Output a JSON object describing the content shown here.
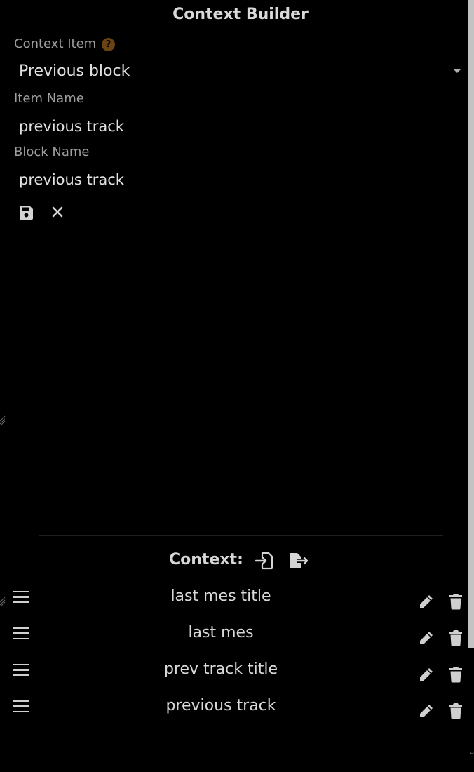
{
  "panel": {
    "title": "Context Builder",
    "context_item_label": "Context Item",
    "help_glyph": "?",
    "context_item_value": "Previous block",
    "item_name_label": "Item Name",
    "item_name_value": "previous track",
    "block_name_label": "Block Name",
    "block_name_value": "previous track",
    "save_icon": "floppy-disk-icon",
    "cancel_icon": "close-icon"
  },
  "context": {
    "header": "Context:",
    "import_icon": "file-import-icon",
    "export_icon": "file-export-icon",
    "items": [
      {
        "label": "last mes title"
      },
      {
        "label": "last mes"
      },
      {
        "label": "prev track title"
      },
      {
        "label": "previous track"
      }
    ]
  },
  "colors": {
    "background": "#000000",
    "help_badge": "#6b4413",
    "text": "#d6d6d6",
    "label": "#9e9e9e"
  }
}
